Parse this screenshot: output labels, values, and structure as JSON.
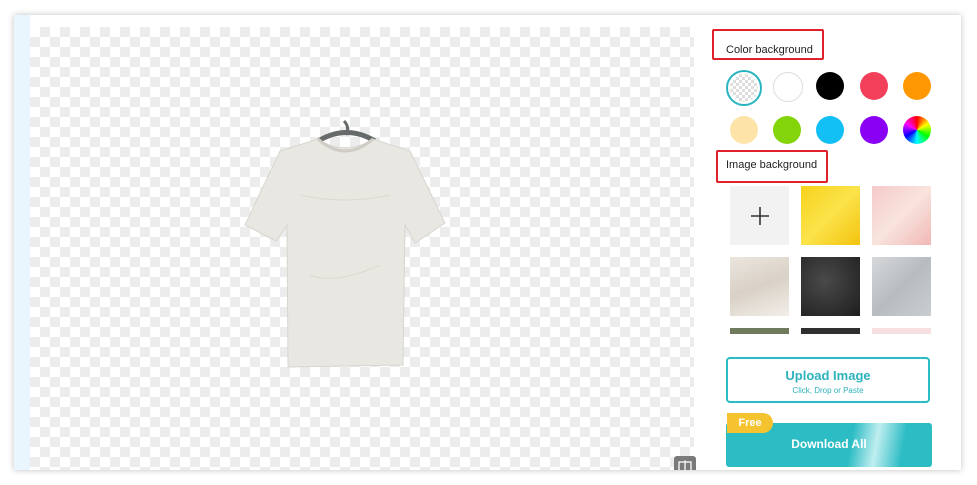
{
  "color_background": {
    "title": "Color background",
    "swatches": [
      {
        "name": "transparent",
        "color": "transparent"
      },
      {
        "name": "white",
        "color": "#ffffff"
      },
      {
        "name": "black",
        "color": "#000000"
      },
      {
        "name": "red",
        "color": "#f2405a"
      },
      {
        "name": "orange",
        "color": "#ff9800"
      },
      {
        "name": "cream",
        "color": "#fde3a7"
      },
      {
        "name": "green",
        "color": "#84d40a"
      },
      {
        "name": "cyan",
        "color": "#12c0f5"
      },
      {
        "name": "purple",
        "color": "#8a00f5"
      },
      {
        "name": "rainbow",
        "color": "conic"
      }
    ]
  },
  "image_background": {
    "title": "Image background",
    "add_icon": "plus-icon"
  },
  "upload": {
    "title": "Upload Image",
    "subtitle": "Click, Drop or Paste"
  },
  "download": {
    "badge": "Free",
    "label": "Download All"
  },
  "colors": {
    "accent": "#2cbcc4",
    "highlight_box": "#e0202a",
    "badge": "#f5c230"
  }
}
